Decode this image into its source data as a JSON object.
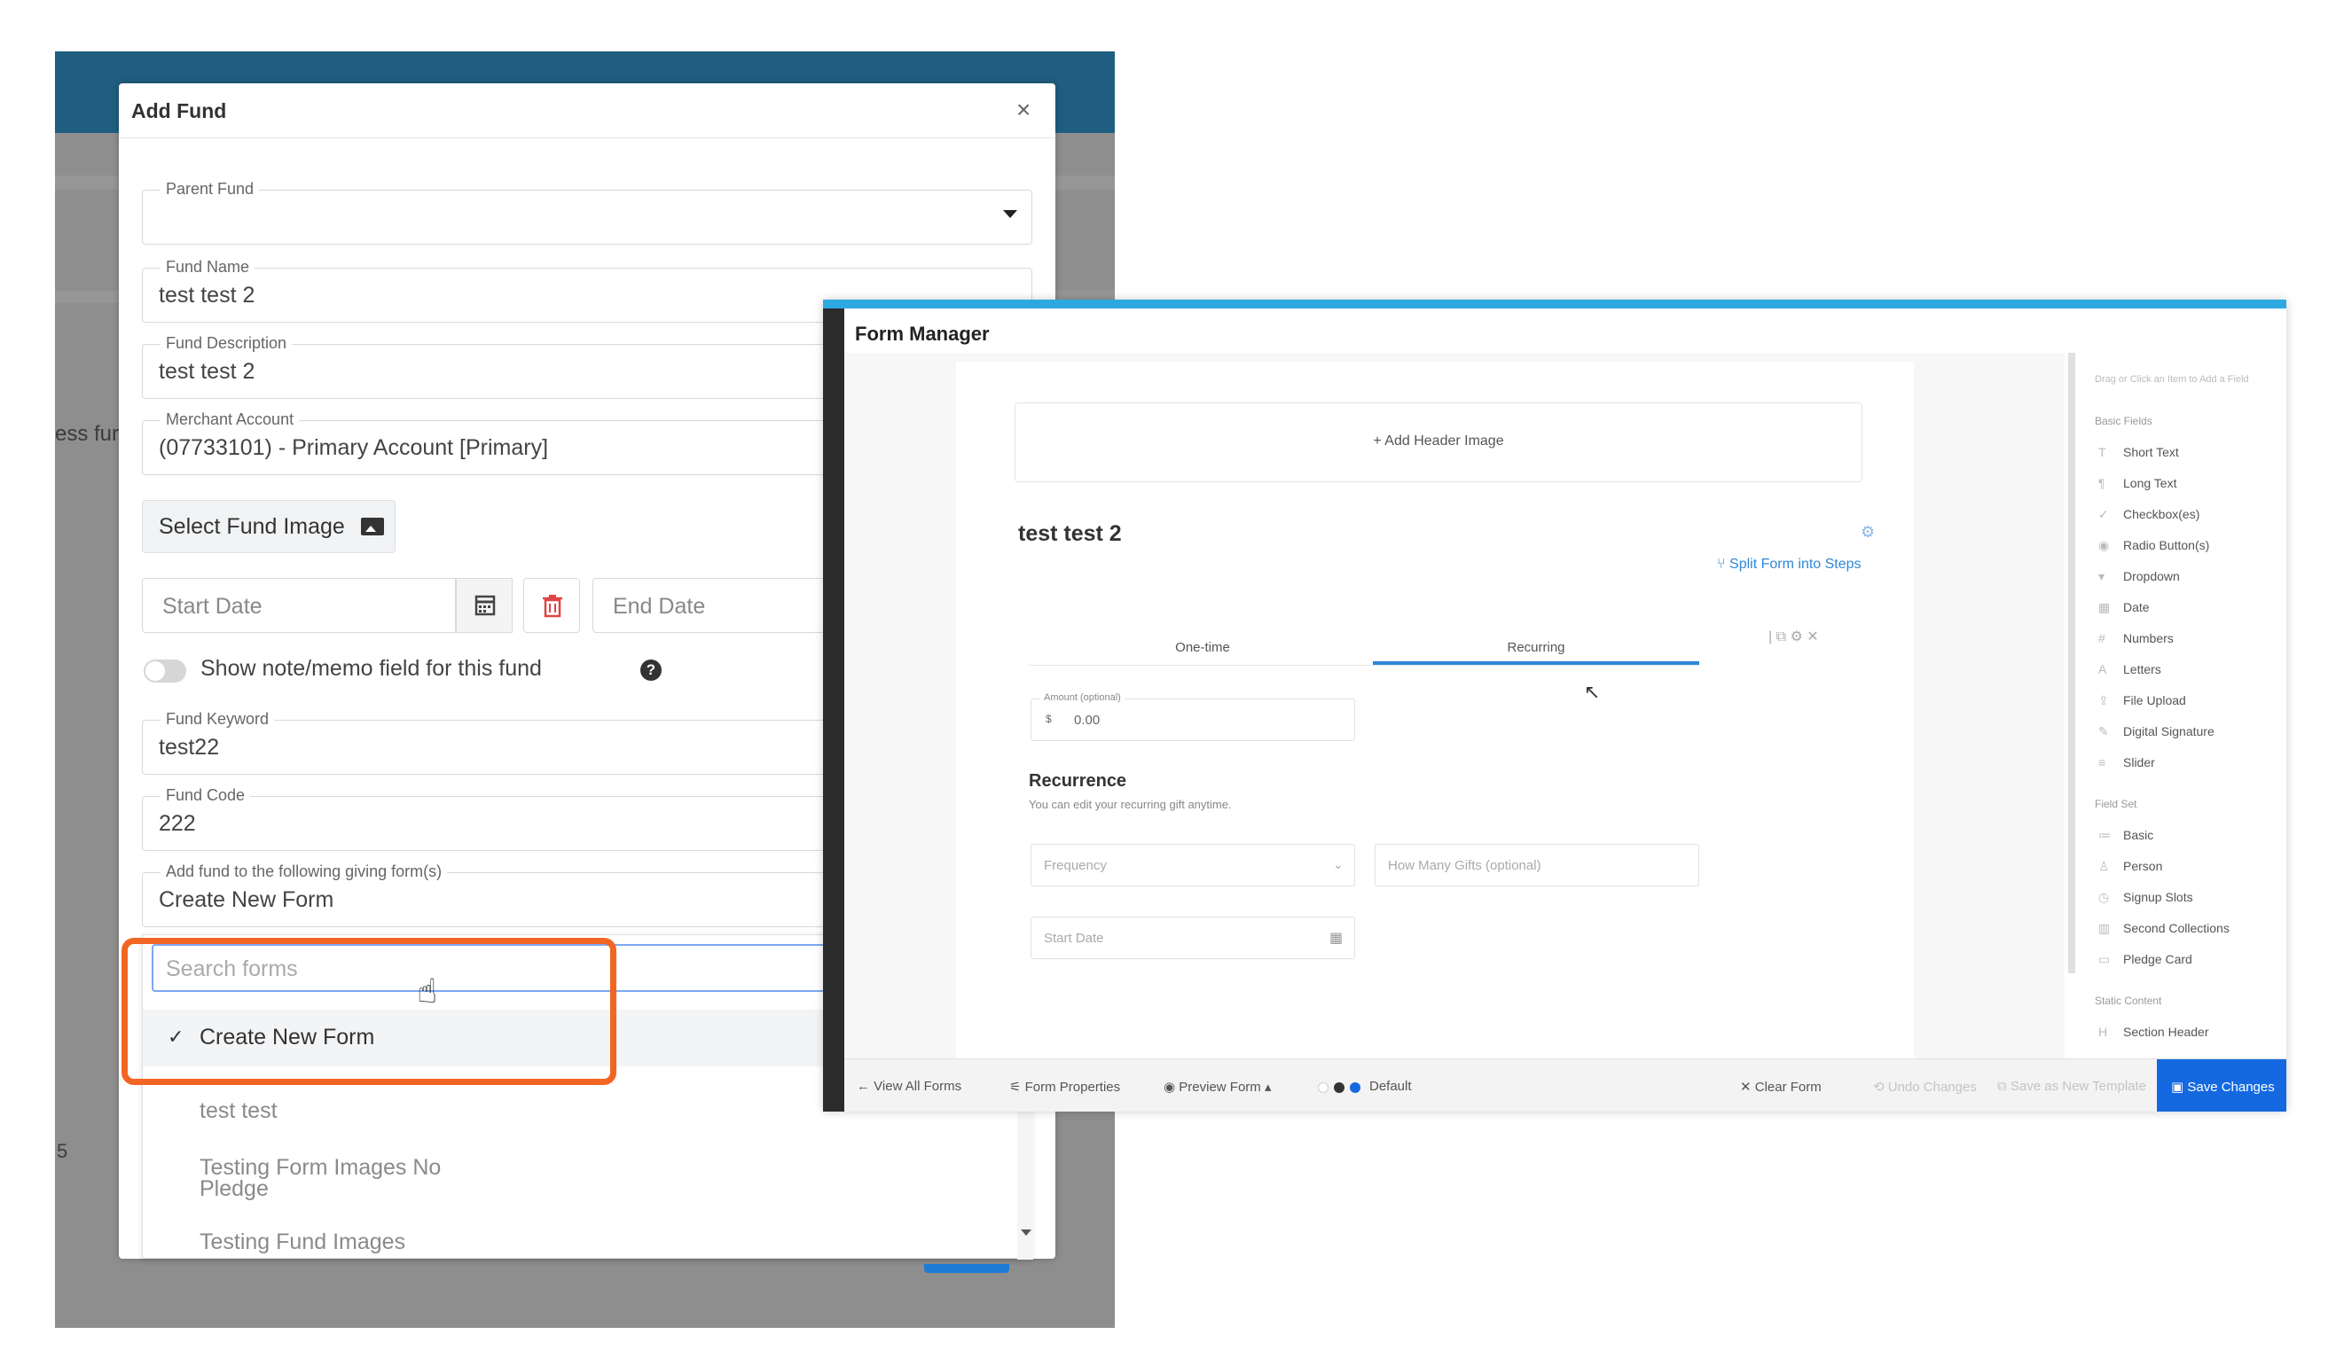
{
  "background_app": {
    "partial_text": "ess fur",
    "partial_number": "5"
  },
  "modal": {
    "title": "Add Fund",
    "close_icon": "×",
    "fields": {
      "parent_fund": {
        "label": "Parent Fund",
        "value": ""
      },
      "fund_name": {
        "label": "Fund Name",
        "value": "test test 2"
      },
      "fund_description": {
        "label": "Fund Description",
        "value": "test test 2"
      },
      "merchant_account": {
        "label": "Merchant Account",
        "value": "(07733101) - Primary Account [Primary]"
      },
      "fund_keyword": {
        "label": "Fund Keyword",
        "value": "test22"
      },
      "fund_code": {
        "label": "Fund Code",
        "value": "222"
      },
      "giving_forms": {
        "label": "Add fund to the following giving form(s)",
        "value": "Create New Form"
      }
    },
    "select_image_label": "Select Fund Image",
    "start_date_placeholder": "Start Date",
    "end_date_placeholder": "End Date",
    "memo_toggle_label": "Show note/memo field for this fund",
    "help_glyph": "?",
    "dropdown": {
      "search_placeholder": "Search forms",
      "selected_check": "✓",
      "options": [
        "Create New Form",
        "test test",
        "Testing Form Images No",
        "Pledge",
        "Testing Fund Images"
      ]
    }
  },
  "form_manager": {
    "title": "Form Manager",
    "add_header_image": "+   Add Header Image",
    "form_title": "test test 2",
    "split_steps": "Split Form into Steps",
    "tabs": [
      "One-time",
      "Recurring"
    ],
    "amount": {
      "label": "Amount  (optional)",
      "currency": "$",
      "value": "0.00"
    },
    "recurrence_title": "Recurrence",
    "recurrence_subtitle": "You can edit your recurring gift anytime.",
    "frequency_placeholder": "Frequency",
    "how_many_placeholder": "How Many Gifts  (optional)",
    "start_date_placeholder": "Start Date",
    "palette": {
      "hint": "Drag or Click an Item to Add a Field",
      "basic_fields_header": "Basic Fields",
      "basic_fields": [
        "Short Text",
        "Long Text",
        "Checkbox(es)",
        "Radio Button(s)",
        "Dropdown",
        "Date",
        "Numbers",
        "Letters",
        "File Upload",
        "Digital Signature",
        "Slider"
      ],
      "field_set_header": "Field Set",
      "field_sets": [
        "Basic",
        "Person",
        "Signup Slots",
        "Second Collections",
        "Pledge Card"
      ],
      "static_content_header": "Static Content",
      "static_content": [
        "Section Header"
      ]
    },
    "footer": {
      "view_all": "View All Forms",
      "properties": "Form Properties",
      "preview": "Preview Form ▴",
      "theme": "Default",
      "clear": "Clear Form",
      "undo": "Undo Changes",
      "save_template": "Save as New Template",
      "save": "Save Changes"
    }
  },
  "colors": {
    "highlight": "#f26522",
    "app_header": "#1f5e80",
    "accent_blue": "#2d87d6",
    "save_button": "#1469e0"
  }
}
